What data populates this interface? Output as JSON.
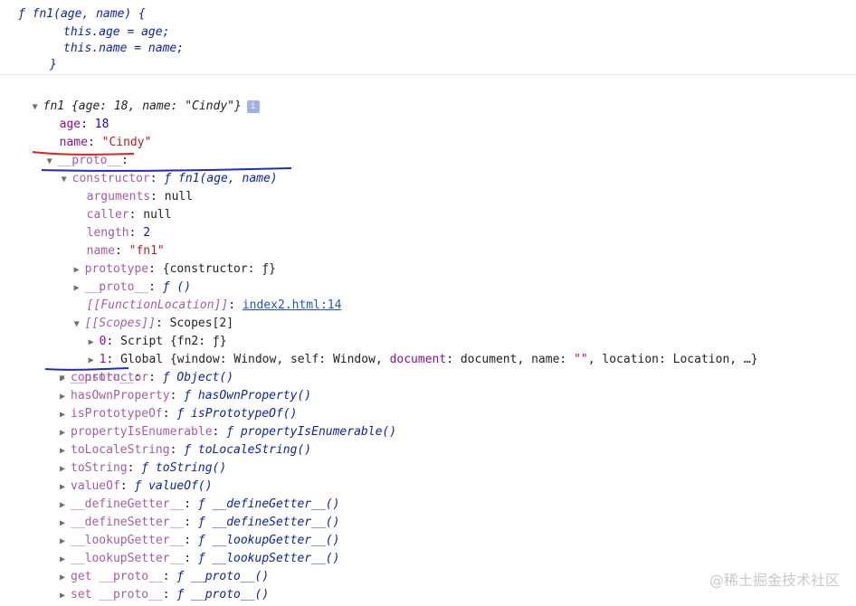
{
  "source": {
    "line1": "ƒ fn1(age, name) {",
    "line2": "this.age = age;",
    "line3": "this.name = name;",
    "line4": "}"
  },
  "object": {
    "header": "fn1 {age: 18, name: \"Cindy\"}",
    "info_badge": "i",
    "age_key": "age",
    "age_value": "18",
    "name_key": "name",
    "name_value": "\"Cindy\"",
    "proto_key": "__proto__",
    "constructor_key": "constructor",
    "constructor_value": "ƒ fn1(age, name)",
    "arguments_key": "arguments",
    "arguments_value": "null",
    "caller_key": "caller",
    "caller_value": "null",
    "length_key": "length",
    "length_value": "2",
    "fname_key": "name",
    "fname_value": "\"fn1\"",
    "prototype_key": "prototype",
    "prototype_value": "{constructor: ƒ}",
    "inner_proto_key": "__proto__",
    "inner_proto_value": "ƒ ()",
    "function_location_key": "[[FunctionLocation]]",
    "function_location_value": "index2.html:14",
    "scopes_key": "[[Scopes]]",
    "scopes_value": "Scopes[2]",
    "scope0_key": "0",
    "scope0_value": "Script {fn2: ƒ}",
    "scope1_key": "1",
    "scope1_prefix": "Global {window: Window, self: Window, ",
    "scope1_document_key": "document",
    "scope1_middle": ": document, name: ",
    "scope1_name_value": "\"\"",
    "scope1_suffix": ", location: Location, …}",
    "proto2_key": "__proto__"
  },
  "object_proto_items": [
    {
      "key": "constructor",
      "value": "ƒ Object()"
    },
    {
      "key": "hasOwnProperty",
      "value": "ƒ hasOwnProperty()"
    },
    {
      "key": "isPrototypeOf",
      "value": "ƒ isPrototypeOf()"
    },
    {
      "key": "propertyIsEnumerable",
      "value": "ƒ propertyIsEnumerable()"
    },
    {
      "key": "toLocaleString",
      "value": "ƒ toLocaleString()"
    },
    {
      "key": "toString",
      "value": "ƒ toString()"
    },
    {
      "key": "valueOf",
      "value": "ƒ valueOf()"
    },
    {
      "key": "__defineGetter__",
      "value": "ƒ __defineGetter__()"
    },
    {
      "key": "__defineSetter__",
      "value": "ƒ __defineSetter__()"
    },
    {
      "key": "__lookupGetter__",
      "value": "ƒ __lookupGetter__()"
    },
    {
      "key": "__lookupSetter__",
      "value": "ƒ __lookupSetter__()"
    },
    {
      "key": "get __proto__",
      "value": "ƒ __proto__()"
    },
    {
      "key": "set __proto__",
      "value": "ƒ __proto__()"
    }
  ],
  "watermark": "@稀土掘金技术社区",
  "colors": {
    "key": "#881391",
    "number": "#1c00cf",
    "string": "#c41a16",
    "function_keyword": "#0d22aa",
    "annotation_red": "#e0201c",
    "annotation_blue": "#1b2bc9"
  }
}
